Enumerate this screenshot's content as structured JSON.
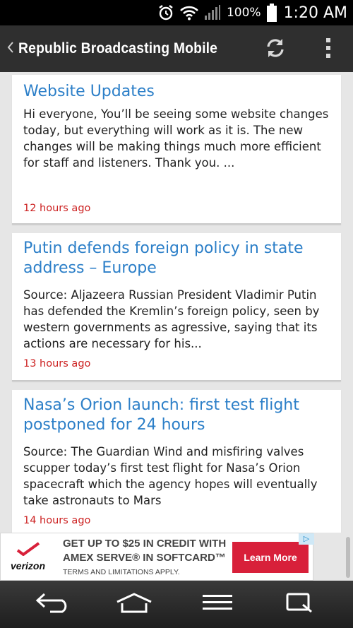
{
  "status_bar": {
    "battery_percent": "100%",
    "time": "1:20 AM",
    "icons": [
      "alarm-icon",
      "wifi-icon",
      "signal-icon",
      "battery-icon"
    ]
  },
  "action_bar": {
    "title": "Republic Broadcasting Mobile",
    "icons": [
      "back-chevron-icon",
      "refresh-icon",
      "overflow-menu-icon"
    ]
  },
  "feed": {
    "items": [
      {
        "title": "Website Updates",
        "body": "Hi everyone, You’ll be seeing some website changes today, but everything will work as it is. The new changes will be making things much more efficient for staff and listeners. Thank you. ...",
        "time": "12 hours ago"
      },
      {
        "title": "Putin defends foreign policy in state address – Europe",
        "body": "Source: Aljazeera Russian President Vladimir Putin has defended the Kremlin’s foreign policy, seen by western governments as agressive, saying that its actions are necessary for his...",
        "time": "13 hours ago"
      },
      {
        "title": "Nasa’s Orion launch: first test flight postponed for 24 hours",
        "body": "Source: The Guardian Wind and misfiring valves scupper today’s first test flight for Nasa’s Orion spacecraft which the agency hopes will eventually take astronauts to Mars",
        "time": "14 hours ago"
      }
    ]
  },
  "ad": {
    "brand": "verizon",
    "line1": "GET UP TO $25 IN CREDIT WITH",
    "line2": "AMEX SERVE® IN SOFTCARD™",
    "line3": "TERMS AND LIMITATIONS APPLY.",
    "cta": "Learn More",
    "adchoices": "▷"
  },
  "nav_bar": {
    "icons": [
      "back-icon",
      "home-icon",
      "menu-icon",
      "recent-apps-icon"
    ]
  },
  "colors": {
    "title_blue": "#2c7fc8",
    "time_red": "#cc2020",
    "action_bar": "#2f2f2f",
    "cta_red": "#d8203a"
  }
}
